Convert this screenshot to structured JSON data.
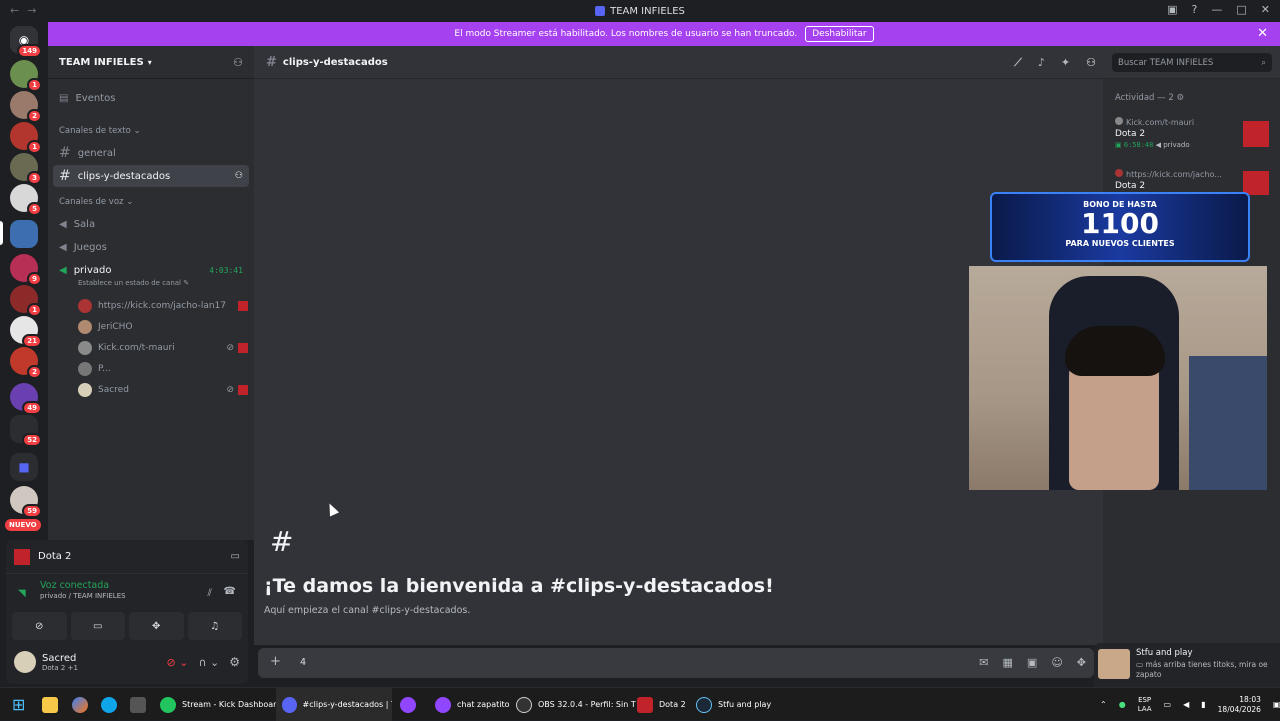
{
  "titlebar": {
    "title": "TEAM INFIELES"
  },
  "banner": {
    "text": "El modo Streamer está habilitado. Los nombres de usuario se han truncado.",
    "button": "Deshabilitar"
  },
  "guilds": {
    "badges": [
      "149",
      "1",
      "2",
      "1",
      "3",
      "5",
      "9",
      "1",
      "21",
      "2",
      "49",
      "52",
      "59"
    ],
    "new_label": "NUEVO"
  },
  "server": {
    "name": "TEAM INFIELES",
    "events": "Eventos",
    "text_category": "Canales de texto",
    "voice_category": "Canales de voz",
    "text_channels": [
      "general",
      "clips-y-destacados"
    ],
    "voice_channels": [
      "Sala",
      "Juegos",
      "privado"
    ],
    "voice_timer": "4:03:41",
    "voice_status": "Establece un estado de canal",
    "voice_users": [
      "https://kick.com/jacho-lan17",
      "JeriCHO",
      "Kick.com/t-mauri",
      "P...",
      "Sacred"
    ]
  },
  "panel": {
    "game": "Dota 2",
    "voice_status": "Voz conectada",
    "voice_location": "privado / TEAM INFIELES",
    "username": "Sacred",
    "user_status": "Dota 2 +1"
  },
  "chat": {
    "channel": "clips-y-destacados",
    "welcome_title": "¡Te damos la bienvenida a #clips-y-destacados!",
    "welcome_sub": "Aquí empieza el canal #clips-y-destacados.",
    "composer_value": "4"
  },
  "search": {
    "placeholder": "Buscar TEAM INFIELES"
  },
  "activity": {
    "header": "Actividad — 2",
    "items": [
      {
        "user": "Kick.com/t-mauri",
        "game": "Dota 2",
        "time": "6:58:48",
        "channel": "privado"
      },
      {
        "user": "https://kick.com/jacho...",
        "game": "Dota 2"
      }
    ]
  },
  "overlay": {
    "line1": "BONO DE HASTA",
    "line2": "1100",
    "line3": "PARA NUEVOS CLIENTES"
  },
  "toast": {
    "title": "Stfu and play",
    "text": "más arriba tienes titoks, mira oe zapato"
  },
  "taskbar": {
    "apps": [
      "Stream - Kick Dashboar",
      "#clips-y-destacados | TE",
      "chat zapatito",
      "OBS 32.0.4 - Perfil: Sin T",
      "Dota 2",
      "Stfu and play"
    ],
    "lang1": "ESP",
    "lang2": "LAA",
    "time": "18:03",
    "date": "18/04/2026"
  },
  "colors": {
    "accent": "#a641f0",
    "green": "#23a55a",
    "red": "#f23f43"
  }
}
